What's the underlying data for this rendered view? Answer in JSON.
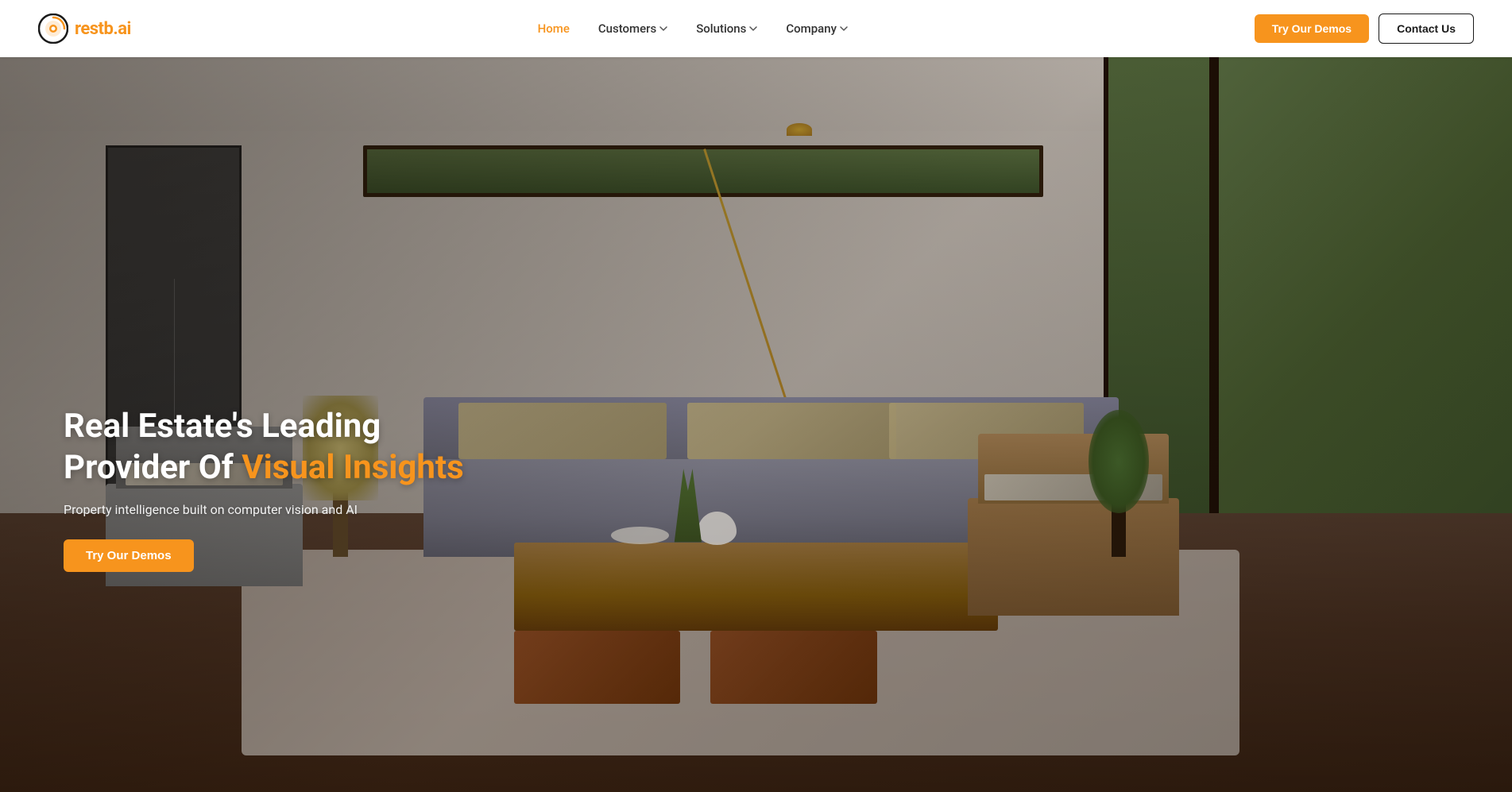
{
  "brand": {
    "name_plain": "restb",
    "name_accent": ".ai",
    "logo_alt": "restb.ai logo"
  },
  "navbar": {
    "home_label": "Home",
    "customers_label": "Customers",
    "solutions_label": "Solutions",
    "company_label": "Company",
    "try_demos_label": "Try Our Demos",
    "contact_label": "Contact Us"
  },
  "hero": {
    "title_plain": "Real Estate's Leading Provider Of ",
    "title_highlight": "Visual Insights",
    "subtitle": "Property intelligence built on computer vision and AI",
    "cta_label": "Try Our Demos"
  },
  "colors": {
    "orange": "#f7941d",
    "dark": "#1a1a1a",
    "white": "#ffffff"
  }
}
